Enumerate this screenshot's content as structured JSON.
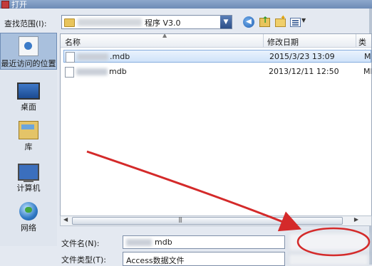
{
  "window": {
    "title": "打开"
  },
  "toolbar": {
    "lookin_label": "查找范围(I):",
    "lookin_value": "程序 V3.0",
    "back_icon": "back-arrow-icon",
    "up_icon": "up-folder-icon",
    "newfolder_icon": "new-folder-icon",
    "view_icon": "view-menu-icon"
  },
  "places": [
    {
      "label": "最近访问的位置",
      "icon": "recent-places-icon"
    },
    {
      "label": "桌面",
      "icon": "desktop-icon"
    },
    {
      "label": "库",
      "icon": "libraries-icon"
    },
    {
      "label": "计算机",
      "icon": "computer-icon"
    },
    {
      "label": "网络",
      "icon": "network-icon"
    }
  ],
  "filelist": {
    "headers": {
      "name": "名称",
      "date": "修改日期",
      "type": "类型"
    },
    "rows": [
      {
        "name": ".mdb",
        "date": "2015/3/23 13:09",
        "type": "MD",
        "selected": true
      },
      {
        "name": "mdb",
        "date": "2013/12/11 12:50",
        "type": "MD",
        "selected": false
      }
    ]
  },
  "form": {
    "filename_label": "文件名(N):",
    "filename_value": "mdb",
    "filetype_label": "文件类型(T):",
    "filetype_value": "Access数据文件"
  },
  "colors": {
    "selection": "#cfe3f9",
    "annotation": "#d42a2a"
  }
}
